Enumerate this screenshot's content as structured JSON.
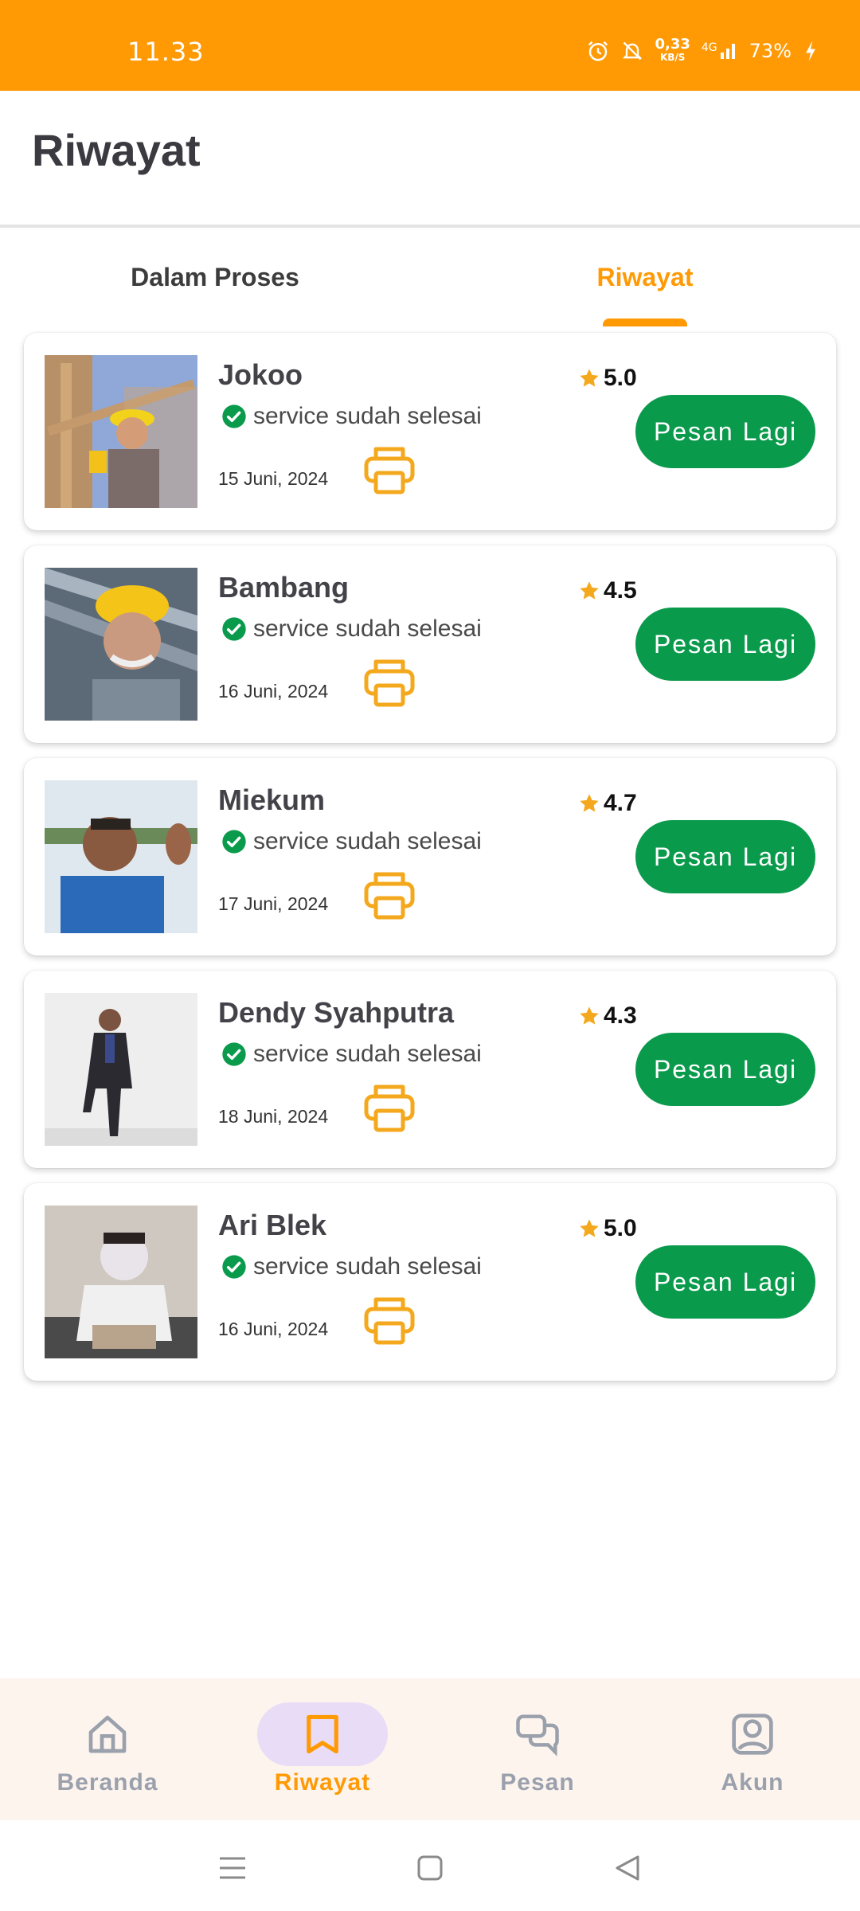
{
  "status_bar": {
    "time": "11.33",
    "speed_value": "0,33",
    "speed_unit": "KB/S",
    "network": "4G",
    "battery": "73%"
  },
  "header": {
    "title": "Riwayat"
  },
  "tabs": [
    {
      "label": "Dalam Proses",
      "active": false
    },
    {
      "label": "Riwayat",
      "active": true
    }
  ],
  "history": [
    {
      "name": "Jokoo",
      "status": "service sudah selesai",
      "date": "15 Juni, 2024",
      "rating": "5.0",
      "button_label": "Pesan Lagi"
    },
    {
      "name": "Bambang",
      "status": "service sudah selesai",
      "date": "16 Juni, 2024",
      "rating": "4.5",
      "button_label": "Pesan Lagi"
    },
    {
      "name": "Miekum",
      "status": "service sudah selesai",
      "date": "17 Juni, 2024",
      "rating": "4.7",
      "button_label": "Pesan Lagi"
    },
    {
      "name": "Dendy Syahputra",
      "status": "service sudah selesai",
      "date": "18 Juni, 2024",
      "rating": "4.3",
      "button_label": "Pesan Lagi"
    },
    {
      "name": "Ari Blek",
      "status": "service sudah selesai",
      "date": "16 Juni, 2024",
      "rating": "5.0",
      "button_label": "Pesan Lagi"
    }
  ],
  "bottom_nav": [
    {
      "label": "Beranda",
      "icon": "home-icon",
      "active": false
    },
    {
      "label": "Riwayat",
      "icon": "bookmark-icon",
      "active": true
    },
    {
      "label": "Pesan",
      "icon": "chat-icon",
      "active": false
    },
    {
      "label": "Akun",
      "icon": "account-icon",
      "active": false
    }
  ],
  "colors": {
    "accent": "#ff9a05",
    "button_green": "#0a9a4c",
    "star": "#f4a81d",
    "nav_active_bg": "#e9dcf6"
  }
}
